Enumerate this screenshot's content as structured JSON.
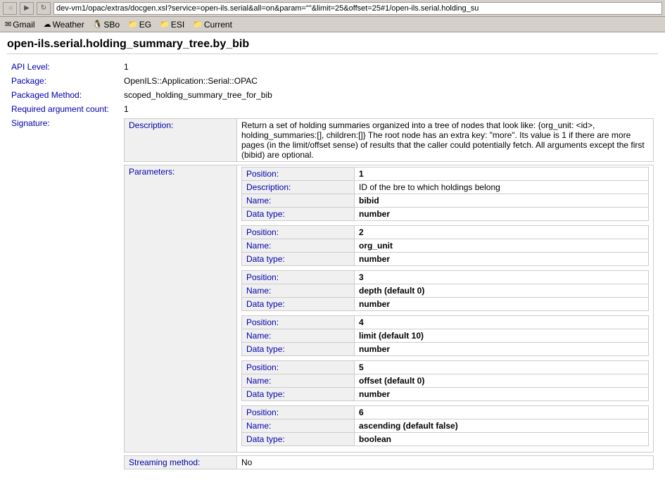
{
  "browser": {
    "address": "dev-vm1/opac/extras/docgen.xsl?service=open-ils.serial&all=on&param=\"\"&limit=25&offset=25#1/open-ils.serial.holding_su",
    "nav": {
      "back": "◀",
      "forward": "▶",
      "reload": "↻"
    }
  },
  "bookmarks": [
    {
      "id": "gmail",
      "icon": "✉",
      "label": "Gmail"
    },
    {
      "id": "weather",
      "icon": "☁",
      "label": "Weather"
    },
    {
      "id": "sbo",
      "icon": "S",
      "label": "SBo"
    },
    {
      "id": "eg",
      "icon": "📁",
      "label": "EG"
    },
    {
      "id": "esi",
      "icon": "📁",
      "label": "ESI"
    },
    {
      "id": "current",
      "icon": "📁",
      "label": "Current"
    }
  ],
  "page": {
    "title": "open-ils.serial.holding_summary_tree.by_bib",
    "api_level_label": "API Level:",
    "api_level_value": "1",
    "package_label": "Package:",
    "package_value": "OpenILS::Application::Serial::OPAC",
    "packaged_method_label": "Packaged Method:",
    "packaged_method_value": "scoped_holding_summary_tree_for_bib",
    "required_arg_count_label": "Required argument count:",
    "required_arg_count_value": "1",
    "signature_label": "Signature:",
    "description_label": "Description:",
    "description_text": "Return a set of holding summaries organized into a tree of nodes that look like: {org_unit: <id>, holding_summaries:[], children:[]} The root node has an extra key: \"more\". Its value is 1 if there are more pages (in the limit/offset sense) of results that the caller could potentially fetch. All arguments except the first (bibid) are optional.",
    "parameters_label": "Parameters:",
    "streaming_method_label": "Streaming method:",
    "streaming_method_value": "No",
    "params": [
      {
        "position_label": "Position:",
        "position_value": "1",
        "description_label": "Description:",
        "description_value": "ID of the bre to which holdings belong",
        "name_label": "Name:",
        "name_value": "bibid",
        "datatype_label": "Data type:",
        "datatype_value": "number"
      },
      {
        "position_label": "Position:",
        "position_value": "2",
        "name_label": "Name:",
        "name_value": "org_unit",
        "datatype_label": "Data type:",
        "datatype_value": "number"
      },
      {
        "position_label": "Position:",
        "position_value": "3",
        "name_label": "Name:",
        "name_value": "depth (default 0)",
        "datatype_label": "Data type:",
        "datatype_value": "number"
      },
      {
        "position_label": "Position:",
        "position_value": "4",
        "name_label": "Name:",
        "name_value": "limit (default 10)",
        "datatype_label": "Data type:",
        "datatype_value": "number"
      },
      {
        "position_label": "Position:",
        "position_value": "5",
        "name_label": "Name:",
        "name_value": "offset (default 0)",
        "datatype_label": "Data type:",
        "datatype_value": "number"
      },
      {
        "position_label": "Position:",
        "position_value": "6",
        "name_label": "Name:",
        "name_value": "ascending (default false)",
        "datatype_label": "Data type:",
        "datatype_value": "boolean"
      }
    ]
  }
}
